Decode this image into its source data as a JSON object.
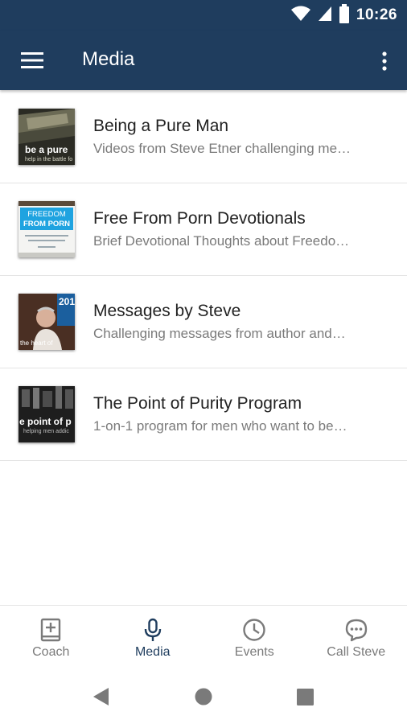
{
  "status_bar": {
    "time": "10:26",
    "icons": [
      "wifi-icon",
      "cell-signal-icon",
      "battery-icon"
    ]
  },
  "app_bar": {
    "title": "Media",
    "icons": [
      "menu-icon",
      "more-vert-icon"
    ]
  },
  "media_items": [
    {
      "title": "Being a Pure Man",
      "subtitle": "Videos from Steve Etner challenging me…"
    },
    {
      "title": "Free From Porn Devotionals",
      "subtitle": "Brief Devotional Thoughts about Freedo…"
    },
    {
      "title": "Messages by Steve",
      "subtitle": "Challenging messages from author and…"
    },
    {
      "title": "The Point of Purity Program",
      "subtitle": "1-on-1 program for men who want to be…"
    }
  ],
  "thumbnails": {
    "t0": {
      "line1": "be a pure",
      "line2": "help in the battle fo"
    },
    "t1": {
      "line1": "FREEDOM",
      "line2": "FROM PORN"
    },
    "t2": {
      "line1": "201",
      "line2": "the heart of"
    },
    "t3": {
      "line1": "e point of p",
      "line2": "helping men addic"
    }
  },
  "bottom_nav": [
    {
      "label": "Coach",
      "icon": "book-plus-icon",
      "active": false
    },
    {
      "label": "Media",
      "icon": "microphone-icon",
      "active": true
    },
    {
      "label": "Events",
      "icon": "clock-icon",
      "active": false
    },
    {
      "label": "Call Steve",
      "icon": "chat-bubble-icon",
      "active": false
    }
  ],
  "colors": {
    "primary": "#1f3d5e",
    "text": "#222222",
    "subtext": "#7a7a7a",
    "inactive": "#7a7a7a",
    "divider": "#e4e4e4"
  }
}
